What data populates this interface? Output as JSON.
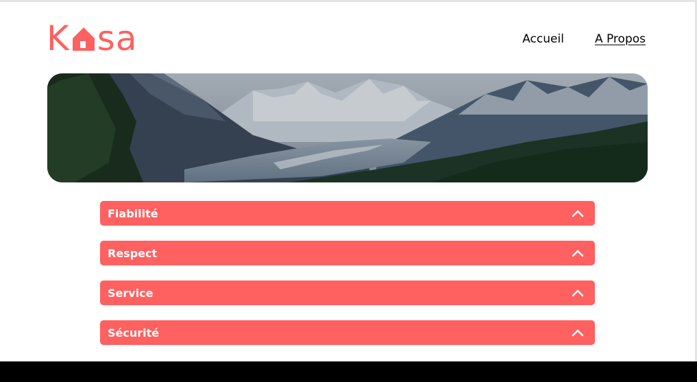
{
  "brand": {
    "logo_prefix": "K",
    "logo_suffix": "sa",
    "color": "#FF6060"
  },
  "nav": {
    "items": [
      {
        "label": "Accueil",
        "active": false
      },
      {
        "label": "A Propos",
        "active": true
      }
    ]
  },
  "collapses": [
    {
      "title": "Fiabilité",
      "icon": "chevron-up-icon"
    },
    {
      "title": "Respect",
      "icon": "chevron-up-icon"
    },
    {
      "title": "Service",
      "icon": "chevron-up-icon"
    },
    {
      "title": "Sécurité",
      "icon": "chevron-up-icon"
    }
  ],
  "colors": {
    "accent": "#FF6060",
    "footer": "#000000"
  }
}
